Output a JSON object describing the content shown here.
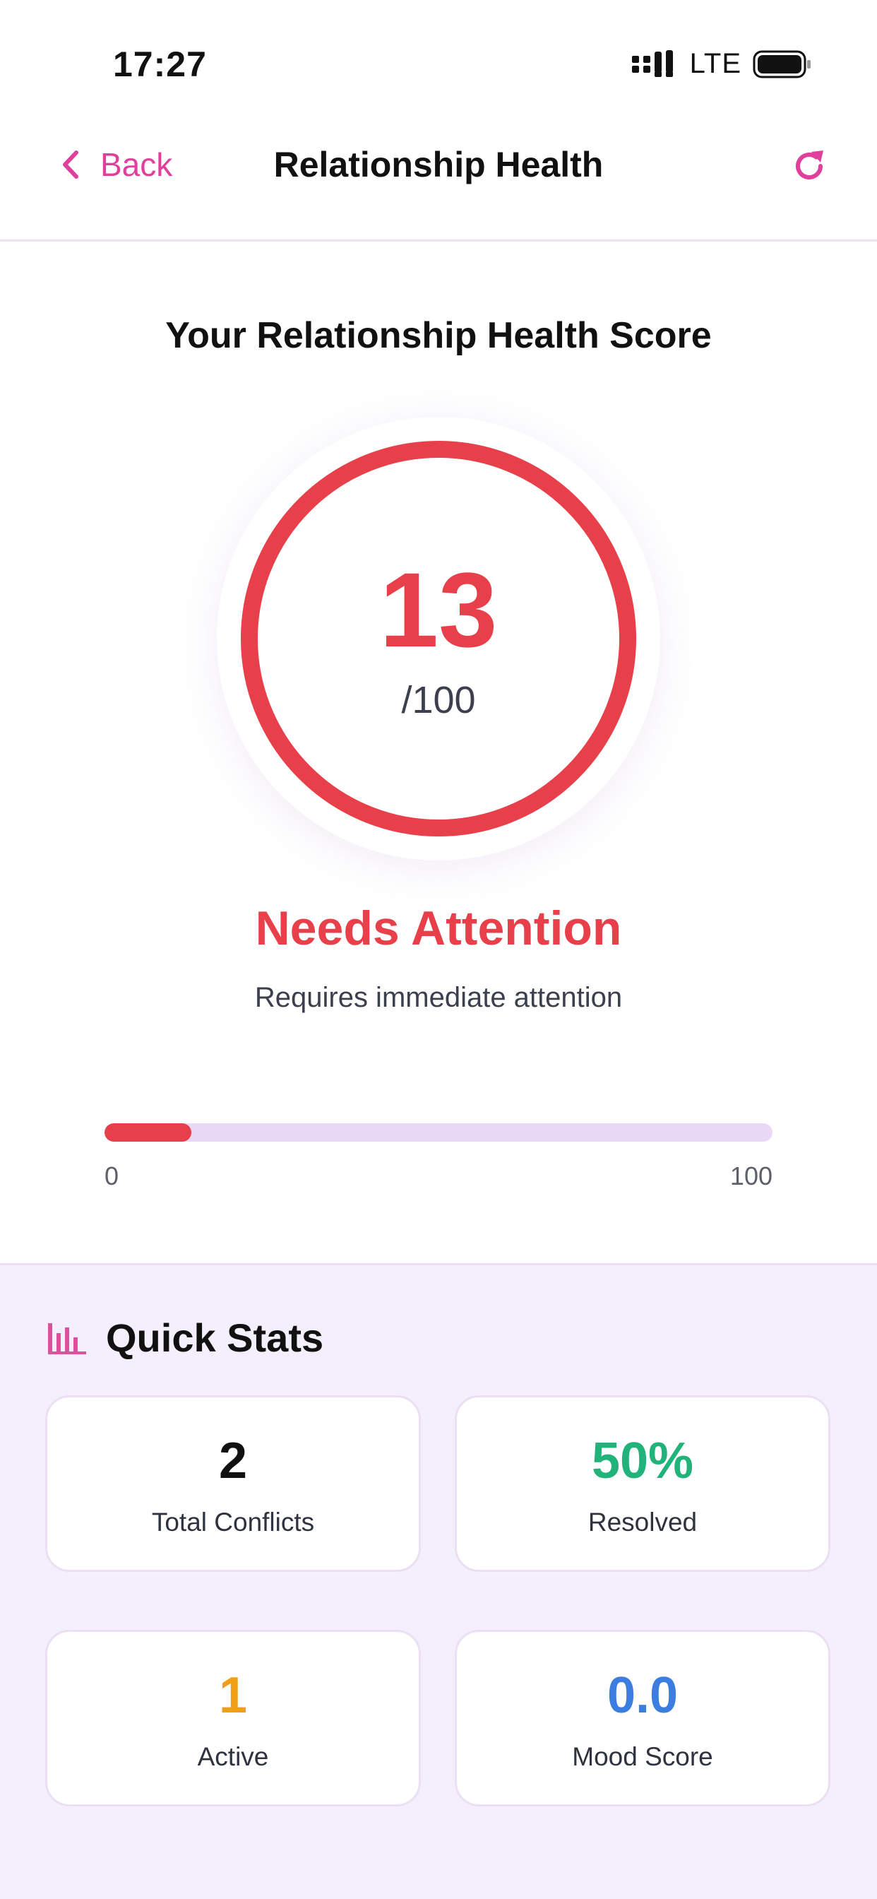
{
  "status_bar": {
    "time": "17:27",
    "network": "LTE",
    "icons": [
      "signal-icon",
      "battery-icon"
    ]
  },
  "nav": {
    "back_label": "Back",
    "title": "Relationship Health",
    "icons": [
      "chevron-left-icon",
      "refresh-icon"
    ]
  },
  "score": {
    "heading": "Your Relationship Health Score",
    "value": "13",
    "max_label": "/100",
    "value_fraction": 0.13,
    "status_title": "Needs Attention",
    "status_subtitle": "Requires immediate attention",
    "progress": {
      "min_label": "0",
      "max_label": "100",
      "value_percent": 13
    }
  },
  "quick_stats": {
    "title": "Quick Stats",
    "icon": "bar-chart-icon",
    "cards": [
      {
        "value": "2",
        "label": "Total Conflicts",
        "color": "#111111"
      },
      {
        "value": "50%",
        "label": "Resolved",
        "color": "#22b37a"
      },
      {
        "value": "1",
        "label": "Active",
        "color": "#f0a017"
      },
      {
        "value": "0.0",
        "label": "Mood Score",
        "color": "#3b7ee0"
      }
    ]
  },
  "colors": {
    "accent": "#e0409b",
    "danger": "#e8404a",
    "progress_track": "#ead8f7",
    "stats_background": "#f3effd"
  }
}
